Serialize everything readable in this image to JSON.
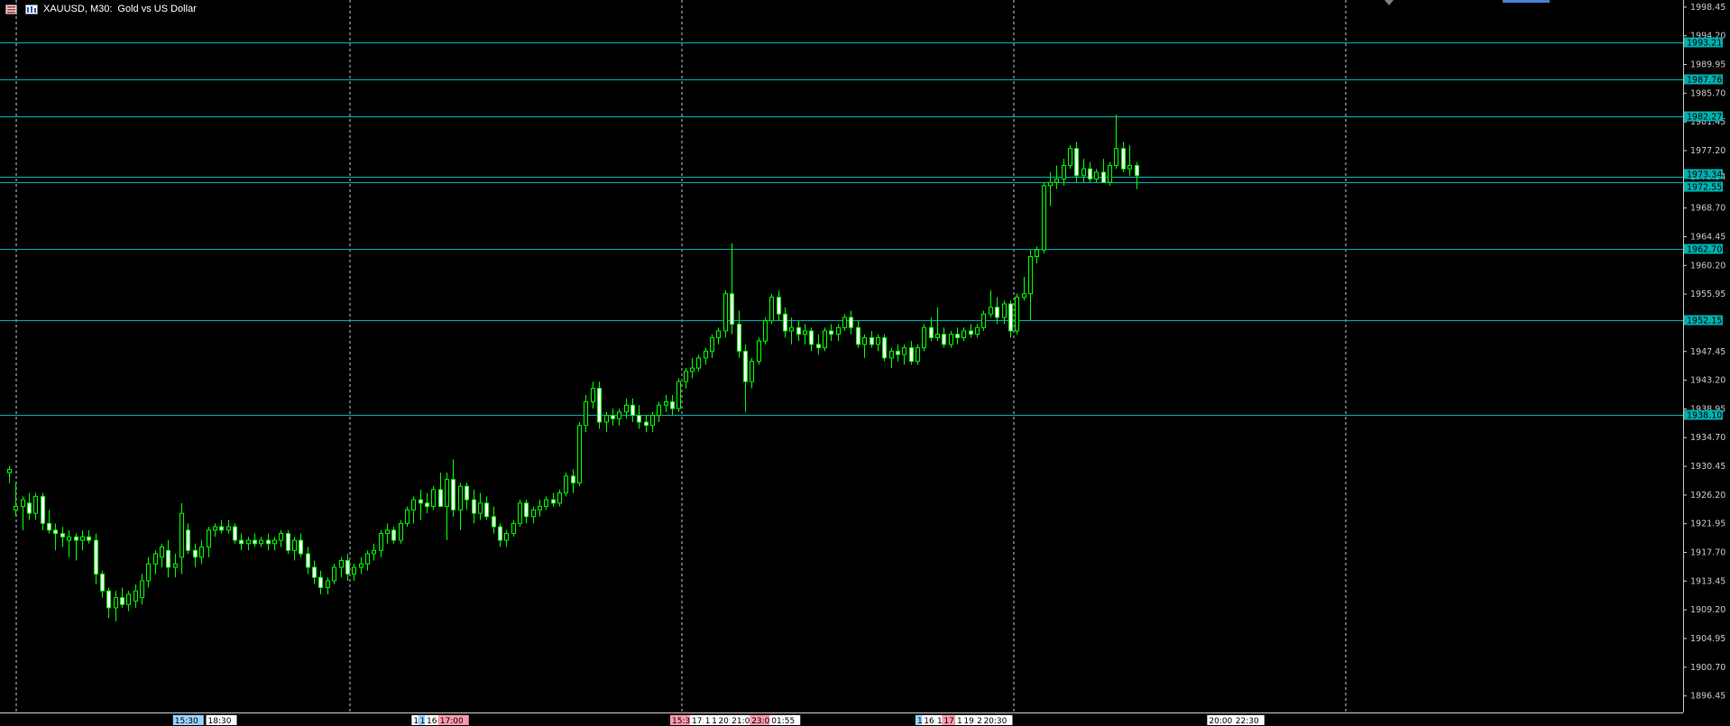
{
  "header": {
    "symbol_period": "XAUUSD, M30:",
    "description": "Gold vs US Dollar"
  },
  "colors": {
    "background": "#000000",
    "candle": "#00ff00",
    "level_line": "#00b0b0",
    "axis_text": "#c8c8c8",
    "grid": "#c8c8c8"
  },
  "chart_data": {
    "type": "candlestick",
    "symbol": "XAUUSD",
    "timeframe": "M30",
    "ylim": [
      1894.0,
      1999.5
    ],
    "price_ticks": [
      1998.45,
      1994.2,
      1989.95,
      1985.7,
      1981.45,
      1977.2,
      1973.34,
      1968.7,
      1964.45,
      1960.2,
      1955.95,
      1947.45,
      1943.2,
      1938.95,
      1934.7,
      1930.45,
      1926.2,
      1921.95,
      1917.7,
      1913.45,
      1909.2,
      1904.95,
      1900.7,
      1896.45
    ],
    "levels": [
      {
        "price": 1993.21,
        "label": "1993.21"
      },
      {
        "price": 1987.76,
        "label": "1987.76"
      },
      {
        "price": 1982.27,
        "label": "1982.27"
      },
      {
        "price": 1973.34,
        "label": "1973.34"
      },
      {
        "price": 1972.55,
        "label": "1972.55"
      },
      {
        "price": 1962.7,
        "label": "1962.70"
      },
      {
        "price": 1952.15,
        "label": "1952.15"
      },
      {
        "price": 1938.1,
        "label": "1938.10"
      }
    ],
    "session_separators": 5,
    "time_labels": [
      {
        "slot": 25,
        "text": "15:30",
        "color": "#9ad0ff"
      },
      {
        "slot": 30,
        "text": "18:30",
        "color": "#ffffff"
      },
      {
        "slot": 61,
        "text": "1",
        "color": "#ffffff"
      },
      {
        "slot": 62,
        "text": "1",
        "color": "#9ad0ff"
      },
      {
        "slot": 63,
        "text": "16:",
        "color": "#ffffff"
      },
      {
        "slot": 65,
        "text": "17:00",
        "color": "#ff9aa8"
      },
      {
        "slot": 100,
        "text": "15:30",
        "color": "#ff9aa8"
      },
      {
        "slot": 103,
        "text": "17:30",
        "color": "#ffffff"
      },
      {
        "slot": 105,
        "text": "1",
        "color": "#ffffff"
      },
      {
        "slot": 106,
        "text": "1",
        "color": "#ffffff"
      },
      {
        "slot": 107,
        "text": "20:",
        "color": "#ffffff"
      },
      {
        "slot": 109,
        "text": "21:00",
        "color": "#ffffff"
      },
      {
        "slot": 112,
        "text": "23:00",
        "color": "#ff9aa8"
      },
      {
        "slot": 115,
        "text": "01:55",
        "color": "#ffffff"
      },
      {
        "slot": 137,
        "text": "1",
        "color": "#9ad0ff"
      },
      {
        "slot": 138,
        "text": "16:",
        "color": "#ffffff"
      },
      {
        "slot": 140,
        "text": "1",
        "color": "#ffffff"
      },
      {
        "slot": 141,
        "text": "17:",
        "color": "#ff9aa8"
      },
      {
        "slot": 143,
        "text": "1",
        "color": "#ffffff"
      },
      {
        "slot": 144,
        "text": "19:",
        "color": "#ffffff"
      },
      {
        "slot": 146,
        "text": "2",
        "color": "#ffffff"
      },
      {
        "slot": 147,
        "text": "20:30",
        "color": "#ffffff"
      },
      {
        "slot": 181,
        "text": "20:00",
        "color": "#ffffff"
      },
      {
        "slot": 185,
        "text": "22:30",
        "color": "#ffffff"
      }
    ],
    "candles": [
      [
        1929.5,
        1930.5,
        1927.9,
        1930.0
      ],
      [
        1924.0,
        1928.0,
        1923.0,
        1924.5
      ],
      [
        1924.5,
        1926.0,
        1921.0,
        1925.5
      ],
      [
        1925.0,
        1926.5,
        1922.5,
        1923.5
      ],
      [
        1923.5,
        1926.5,
        1922.5,
        1926.0
      ],
      [
        1926.0,
        1926.5,
        1921.0,
        1922.0
      ],
      [
        1922.0,
        1924.0,
        1920.5,
        1921.0
      ],
      [
        1921.0,
        1922.0,
        1918.0,
        1920.5
      ],
      [
        1920.5,
        1921.5,
        1918.5,
        1920.0
      ],
      [
        1919.5,
        1921.0,
        1917.0,
        1920.0
      ],
      [
        1920.0,
        1920.5,
        1916.5,
        1919.5
      ],
      [
        1919.5,
        1921.0,
        1918.0,
        1920.0
      ],
      [
        1920.0,
        1921.0,
        1919.0,
        1919.5
      ],
      [
        1919.5,
        1920.5,
        1913.0,
        1914.5
      ],
      [
        1914.5,
        1915.0,
        1911.0,
        1912.0
      ],
      [
        1912.0,
        1912.5,
        1908.0,
        1909.5
      ],
      [
        1909.5,
        1912.0,
        1907.5,
        1911.0
      ],
      [
        1911.0,
        1912.5,
        1909.5,
        1910.0
      ],
      [
        1910.0,
        1912.0,
        1909.0,
        1911.5
      ],
      [
        1910.5,
        1913.0,
        1909.5,
        1912.0
      ],
      [
        1911.0,
        1914.5,
        1910.0,
        1913.5
      ],
      [
        1913.5,
        1917.0,
        1912.5,
        1916.0
      ],
      [
        1916.0,
        1918.0,
        1914.5,
        1917.5
      ],
      [
        1917.0,
        1919.0,
        1915.5,
        1918.5
      ],
      [
        1918.0,
        1919.5,
        1914.0,
        1915.5
      ],
      [
        1915.5,
        1917.5,
        1914.0,
        1916.0
      ],
      [
        1917.0,
        1925.0,
        1914.5,
        1923.5
      ],
      [
        1921.0,
        1922.0,
        1917.5,
        1918.0
      ],
      [
        1918.0,
        1919.0,
        1915.5,
        1917.0
      ],
      [
        1917.0,
        1919.5,
        1916.0,
        1918.5
      ],
      [
        1918.5,
        1921.5,
        1917.0,
        1921.0
      ],
      [
        1921.0,
        1922.0,
        1920.0,
        1921.5
      ],
      [
        1921.5,
        1922.5,
        1920.5,
        1921.0
      ],
      [
        1921.0,
        1922.5,
        1920.5,
        1921.5
      ],
      [
        1921.5,
        1922.0,
        1919.0,
        1919.5
      ],
      [
        1919.5,
        1920.5,
        1918.0,
        1919.0
      ],
      [
        1919.0,
        1920.0,
        1918.0,
        1919.5
      ],
      [
        1919.5,
        1920.5,
        1918.5,
        1919.0
      ],
      [
        1919.0,
        1920.0,
        1918.5,
        1919.5
      ],
      [
        1919.5,
        1920.5,
        1918.0,
        1919.0
      ],
      [
        1919.0,
        1920.0,
        1918.0,
        1919.5
      ],
      [
        1919.5,
        1921.0,
        1918.5,
        1920.5
      ],
      [
        1920.5,
        1921.0,
        1917.5,
        1918.0
      ],
      [
        1918.0,
        1920.0,
        1916.5,
        1919.5
      ],
      [
        1919.5,
        1920.5,
        1917.0,
        1917.5
      ],
      [
        1917.5,
        1918.5,
        1914.5,
        1915.5
      ],
      [
        1915.5,
        1916.5,
        1913.0,
        1914.0
      ],
      [
        1914.0,
        1915.0,
        1911.5,
        1912.5
      ],
      [
        1912.5,
        1914.0,
        1911.5,
        1913.5
      ],
      [
        1913.5,
        1916.0,
        1913.0,
        1915.5
      ],
      [
        1915.5,
        1917.0,
        1914.0,
        1916.5
      ],
      [
        1916.5,
        1917.5,
        1913.5,
        1914.5
      ],
      [
        1914.5,
        1916.0,
        1913.5,
        1915.5
      ],
      [
        1915.5,
        1917.0,
        1914.5,
        1916.0
      ],
      [
        1916.0,
        1918.0,
        1915.0,
        1917.5
      ],
      [
        1917.5,
        1919.0,
        1916.5,
        1918.0
      ],
      [
        1918.0,
        1921.0,
        1917.0,
        1920.5
      ],
      [
        1920.5,
        1922.0,
        1919.0,
        1921.0
      ],
      [
        1921.0,
        1921.5,
        1919.0,
        1919.5
      ],
      [
        1919.5,
        1922.5,
        1919.0,
        1922.0
      ],
      [
        1922.0,
        1924.5,
        1921.5,
        1924.0
      ],
      [
        1924.0,
        1926.0,
        1922.0,
        1925.5
      ],
      [
        1925.5,
        1927.0,
        1922.5,
        1925.0
      ],
      [
        1925.0,
        1926.5,
        1923.5,
        1924.5
      ],
      [
        1924.5,
        1927.5,
        1924.0,
        1927.0
      ],
      [
        1927.0,
        1929.5,
        1925.5,
        1924.5
      ],
      [
        1924.5,
        1929.5,
        1919.5,
        1928.5
      ],
      [
        1928.5,
        1931.5,
        1923.0,
        1924.0
      ],
      [
        1924.0,
        1928.0,
        1921.0,
        1927.5
      ],
      [
        1927.5,
        1928.0,
        1924.0,
        1925.5
      ],
      [
        1925.5,
        1927.0,
        1922.0,
        1923.5
      ],
      [
        1923.5,
        1926.5,
        1922.5,
        1925.0
      ],
      [
        1925.0,
        1926.0,
        1922.5,
        1923.0
      ],
      [
        1923.0,
        1924.5,
        1920.5,
        1921.5
      ],
      [
        1921.5,
        1922.0,
        1918.5,
        1919.5
      ],
      [
        1919.5,
        1921.0,
        1918.5,
        1920.5
      ],
      [
        1920.5,
        1922.5,
        1920.0,
        1922.0
      ],
      [
        1922.0,
        1925.5,
        1921.5,
        1925.0
      ],
      [
        1925.0,
        1925.5,
        1922.0,
        1923.0
      ],
      [
        1923.0,
        1924.5,
        1922.0,
        1924.0
      ],
      [
        1924.0,
        1925.5,
        1923.0,
        1924.5
      ],
      [
        1924.5,
        1926.0,
        1924.0,
        1925.5
      ],
      [
        1925.5,
        1926.5,
        1924.5,
        1925.0
      ],
      [
        1925.0,
        1927.0,
        1924.5,
        1926.5
      ],
      [
        1926.5,
        1929.5,
        1926.0,
        1929.0
      ],
      [
        1929.0,
        1930.0,
        1926.5,
        1928.0
      ],
      [
        1928.0,
        1937.0,
        1927.5,
        1936.5
      ],
      [
        1936.5,
        1941.0,
        1935.5,
        1940.0
      ],
      [
        1940.0,
        1943.0,
        1939.0,
        1942.0
      ],
      [
        1942.0,
        1943.0,
        1936.0,
        1937.0
      ],
      [
        1937.0,
        1938.5,
        1935.5,
        1938.0
      ],
      [
        1938.0,
        1939.0,
        1936.5,
        1937.5
      ],
      [
        1937.5,
        1939.0,
        1936.5,
        1938.5
      ],
      [
        1938.5,
        1940.5,
        1937.5,
        1939.5
      ],
      [
        1939.5,
        1940.5,
        1937.0,
        1938.0
      ],
      [
        1938.0,
        1939.5,
        1936.0,
        1937.0
      ],
      [
        1937.0,
        1938.0,
        1935.5,
        1936.5
      ],
      [
        1936.5,
        1938.5,
        1935.5,
        1938.0
      ],
      [
        1938.0,
        1940.0,
        1937.0,
        1939.5
      ],
      [
        1939.5,
        1941.0,
        1938.5,
        1940.0
      ],
      [
        1940.0,
        1941.0,
        1938.0,
        1939.0
      ],
      [
        1939.0,
        1943.5,
        1938.5,
        1943.0
      ],
      [
        1943.0,
        1945.0,
        1942.0,
        1944.5
      ],
      [
        1944.5,
        1946.5,
        1943.5,
        1945.0
      ],
      [
        1945.0,
        1947.0,
        1944.5,
        1946.5
      ],
      [
        1946.5,
        1948.0,
        1945.5,
        1947.5
      ],
      [
        1947.5,
        1950.0,
        1946.5,
        1949.5
      ],
      [
        1949.5,
        1951.0,
        1948.5,
        1950.5
      ],
      [
        1950.5,
        1956.5,
        1949.5,
        1956.0
      ],
      [
        1956.0,
        1963.5,
        1950.0,
        1951.5
      ],
      [
        1951.5,
        1953.5,
        1946.5,
        1947.5
      ],
      [
        1947.5,
        1948.5,
        1938.5,
        1943.0
      ],
      [
        1943.0,
        1946.5,
        1942.0,
        1946.0
      ],
      [
        1946.0,
        1949.5,
        1945.5,
        1949.0
      ],
      [
        1949.0,
        1952.5,
        1948.5,
        1952.0
      ],
      [
        1952.0,
        1956.0,
        1951.5,
        1955.5
      ],
      [
        1955.5,
        1956.5,
        1952.0,
        1953.0
      ],
      [
        1953.0,
        1954.0,
        1949.5,
        1950.5
      ],
      [
        1950.5,
        1952.5,
        1948.5,
        1951.0
      ],
      [
        1951.0,
        1952.0,
        1949.0,
        1950.0
      ],
      [
        1950.0,
        1951.5,
        1948.5,
        1950.5
      ],
      [
        1950.5,
        1951.0,
        1947.5,
        1948.5
      ],
      [
        1948.5,
        1950.0,
        1947.0,
        1948.0
      ],
      [
        1948.0,
        1951.0,
        1947.5,
        1950.5
      ],
      [
        1950.5,
        1951.5,
        1949.0,
        1950.0
      ],
      [
        1950.0,
        1951.5,
        1949.0,
        1951.0
      ],
      [
        1951.0,
        1953.0,
        1950.5,
        1952.5
      ],
      [
        1952.5,
        1953.5,
        1950.0,
        1951.0
      ],
      [
        1951.0,
        1952.0,
        1948.0,
        1948.5
      ],
      [
        1948.5,
        1950.0,
        1946.5,
        1949.5
      ],
      [
        1949.5,
        1950.5,
        1948.0,
        1948.5
      ],
      [
        1948.5,
        1950.0,
        1947.5,
        1949.5
      ],
      [
        1949.5,
        1950.0,
        1946.0,
        1946.5
      ],
      [
        1946.5,
        1948.0,
        1945.0,
        1947.5
      ],
      [
        1947.5,
        1948.5,
        1946.0,
        1947.0
      ],
      [
        1947.0,
        1948.5,
        1945.5,
        1948.0
      ],
      [
        1948.0,
        1949.0,
        1945.5,
        1946.0
      ],
      [
        1946.0,
        1948.5,
        1945.5,
        1948.0
      ],
      [
        1948.0,
        1951.5,
        1947.5,
        1951.0
      ],
      [
        1951.0,
        1952.5,
        1949.0,
        1949.5
      ],
      [
        1949.5,
        1954.0,
        1949.0,
        1950.0
      ],
      [
        1950.0,
        1951.0,
        1948.0,
        1948.5
      ],
      [
        1948.5,
        1950.5,
        1948.0,
        1950.0
      ],
      [
        1950.0,
        1951.0,
        1948.5,
        1949.5
      ],
      [
        1949.5,
        1951.0,
        1949.0,
        1950.5
      ],
      [
        1950.5,
        1951.5,
        1949.5,
        1950.0
      ],
      [
        1950.0,
        1951.5,
        1949.5,
        1951.0
      ],
      [
        1951.0,
        1953.5,
        1950.5,
        1953.0
      ],
      [
        1953.0,
        1956.5,
        1952.5,
        1954.0
      ],
      [
        1954.0,
        1955.5,
        1951.5,
        1952.5
      ],
      [
        1952.5,
        1955.0,
        1951.5,
        1954.5
      ],
      [
        1954.5,
        1955.0,
        1949.5,
        1950.5
      ],
      [
        1950.5,
        1956.0,
        1950.0,
        1955.5
      ],
      [
        1955.5,
        1958.5,
        1955.0,
        1956.0
      ],
      [
        1956.0,
        1962.5,
        1952.0,
        1961.5
      ],
      [
        1961.5,
        1963.0,
        1960.5,
        1962.5
      ],
      [
        1962.5,
        1972.5,
        1962.0,
        1972.0
      ],
      [
        1972.0,
        1974.0,
        1969.0,
        1972.5
      ],
      [
        1972.5,
        1975.0,
        1971.5,
        1973.0
      ],
      [
        1973.0,
        1976.0,
        1972.0,
        1975.0
      ],
      [
        1975.0,
        1978.0,
        1974.5,
        1977.5
      ],
      [
        1977.5,
        1978.5,
        1972.5,
        1973.5
      ],
      [
        1973.5,
        1976.0,
        1972.5,
        1974.5
      ],
      [
        1974.5,
        1975.5,
        1972.5,
        1973.0
      ],
      [
        1973.0,
        1974.5,
        1972.5,
        1974.0
      ],
      [
        1974.0,
        1976.0,
        1972.5,
        1972.5
      ],
      [
        1972.5,
        1975.5,
        1972.0,
        1975.0
      ],
      [
        1975.0,
        1982.5,
        1974.5,
        1977.5
      ],
      [
        1977.5,
        1978.5,
        1974.0,
        1974.5
      ],
      [
        1974.5,
        1978.0,
        1973.5,
        1975.0
      ],
      [
        1975.0,
        1975.5,
        1971.5,
        1973.5
      ]
    ]
  }
}
